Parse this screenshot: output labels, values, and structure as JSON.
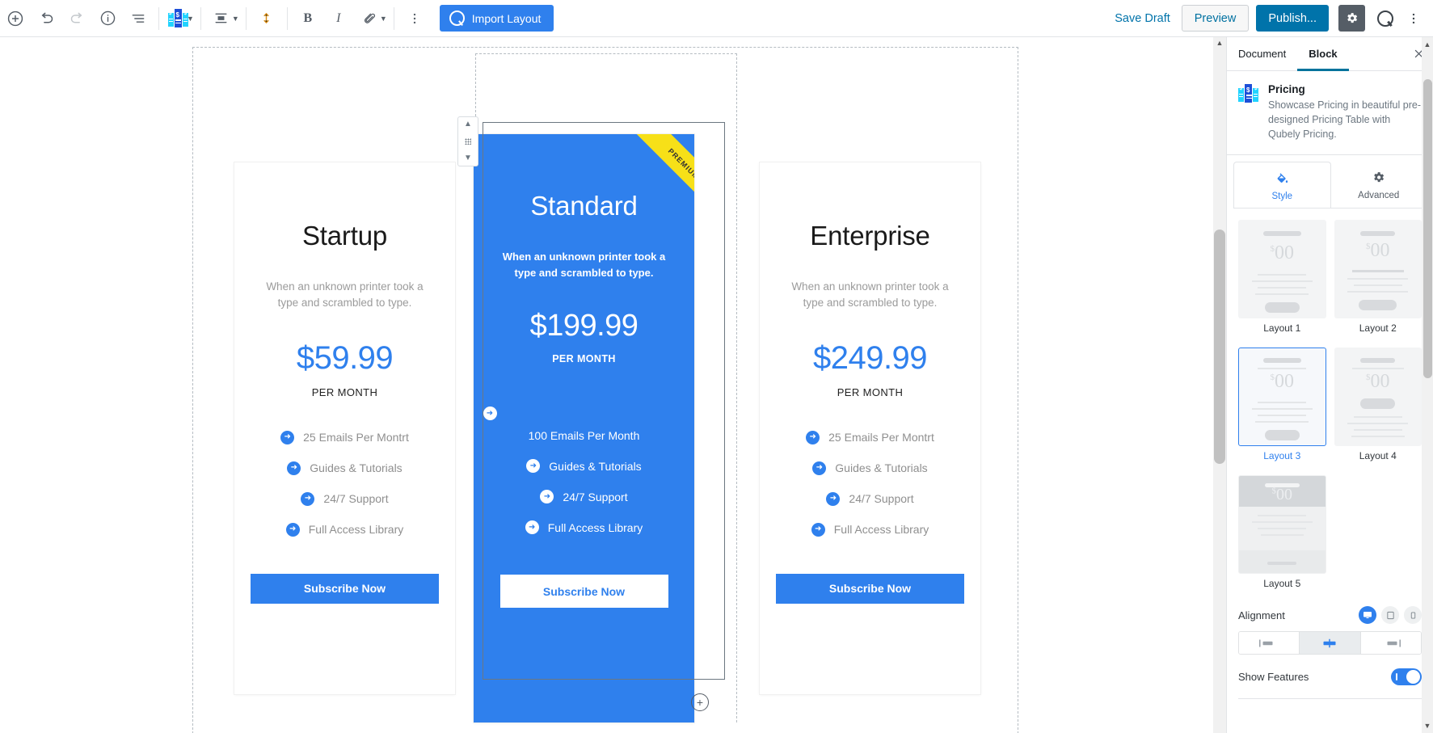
{
  "toolbar": {
    "add_block_icon": "plus-circle-icon",
    "undo_icon": "undo-icon",
    "redo_icon": "redo-icon",
    "info_icon": "info-icon",
    "block_nav_icon": "block-navigation-icon",
    "block_type_icon": "pricing-block-icon",
    "align_icon": "align-center-icon",
    "vertical_spacing_icon": "vertical-spacing-icon",
    "bold_label": "B",
    "italic_label": "I",
    "link_icon": "link-icon",
    "more_icon": "more-vertical-icon",
    "import_layout_label": "Import Layout",
    "import_layout_icon": "qubely-q-icon",
    "save_draft_label": "Save Draft",
    "preview_label": "Preview",
    "publish_label": "Publish...",
    "settings_icon": "gear-icon",
    "qubely_icon": "qubely-q-icon",
    "options_icon": "more-vertical-icon"
  },
  "canvas": {
    "add_block_bottom_icon": "plus-circle-icon",
    "mover": {
      "up_icon": "chevron-up-icon",
      "drag_icon": "drag-handle-icon",
      "down_icon": "chevron-down-icon"
    },
    "pricing_cards": [
      {
        "name": "card-startup",
        "title": "Startup",
        "description": "When an unknown printer took a type and scrambled to type.",
        "price": "$59.99",
        "period": "PER MONTH",
        "features": [
          "25 Emails Per Montrt",
          "Guides & Tutorials",
          "24/7 Support",
          "Full Access Library"
        ],
        "button_label": "Subscribe Now",
        "ribbon": null,
        "featured": false
      },
      {
        "name": "card-standard",
        "title": "Standard",
        "description": "When an unknown printer took a type and scrambled to type.",
        "price": "$199.99",
        "period": "PER MONTH",
        "features": [
          "100 Emails Per Month",
          "Guides & Tutorials",
          "24/7 Support",
          "Full Access Library"
        ],
        "button_label": "Subscribe Now",
        "ribbon": "PREMIUM",
        "featured": true
      },
      {
        "name": "card-enterprise",
        "title": "Enterprise",
        "description": "When an unknown printer took a type and scrambled to type.",
        "price": "$249.99",
        "period": "PER MONTH",
        "features": [
          "25 Emails Per Montrt",
          "Guides & Tutorials",
          "24/7 Support",
          "Full Access Library"
        ],
        "button_label": "Subscribe Now",
        "ribbon": null,
        "featured": false
      }
    ]
  },
  "sidebar": {
    "tabs": [
      {
        "label": "Document",
        "active": false
      },
      {
        "label": "Block",
        "active": true
      }
    ],
    "close_icon": "close-icon",
    "block_info": {
      "icon": "pricing-block-icon",
      "title": "Pricing",
      "description": "Showcase Pricing in beautiful pre-designed Pricing Table with Qubely Pricing."
    },
    "style_tabs": [
      {
        "label": "Style",
        "icon": "paint-bucket-icon",
        "active": true
      },
      {
        "label": "Advanced",
        "icon": "gear-icon",
        "active": false
      }
    ],
    "layouts": [
      {
        "label": "Layout 1",
        "selected": false
      },
      {
        "label": "Layout 2",
        "selected": false
      },
      {
        "label": "Layout 3",
        "selected": true
      },
      {
        "label": "Layout 4",
        "selected": false
      },
      {
        "label": "Layout 5",
        "selected": false
      }
    ],
    "layout_thumb_price": "00",
    "layout_thumb_currency": "$",
    "alignment": {
      "label": "Alignment",
      "devices": [
        {
          "icon": "desktop-icon",
          "active": true
        },
        {
          "icon": "tablet-icon",
          "active": false
        },
        {
          "icon": "mobile-icon",
          "active": false
        }
      ],
      "options": [
        {
          "icon": "align-left-icon",
          "active": false
        },
        {
          "icon": "align-center-icon",
          "active": true
        },
        {
          "icon": "align-right-icon",
          "active": false
        }
      ]
    },
    "show_features": {
      "label": "Show Features",
      "enabled": true
    }
  },
  "colors": {
    "accent": "#2f80ed",
    "publish": "#0073aa",
    "ribbon": "#f7e018",
    "muted_text": "#8f8f8f"
  }
}
